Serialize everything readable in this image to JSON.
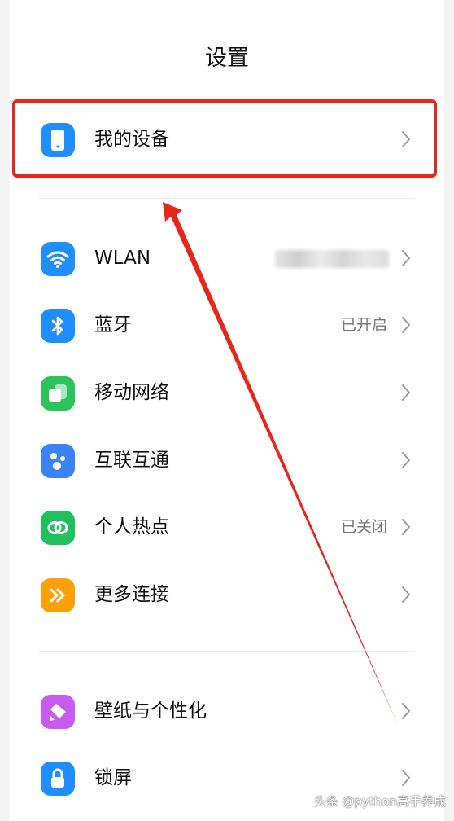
{
  "header": {
    "title": "设置"
  },
  "rows": [
    {
      "label": "我的设备",
      "value": "",
      "icon": "phone-icon",
      "color": "#1f8fff"
    },
    {
      "label": "WLAN",
      "value": "",
      "icon": "wifi-icon",
      "color": "#1f8fff"
    },
    {
      "label": "蓝牙",
      "value": "已开启",
      "icon": "bluetooth-icon",
      "color": "#1f8fff"
    },
    {
      "label": "移动网络",
      "value": "",
      "icon": "mobile-network-icon",
      "color": "#2ac45a"
    },
    {
      "label": "互联互通",
      "value": "",
      "icon": "interconnect-icon",
      "color": "#3b82f6"
    },
    {
      "label": "个人热点",
      "value": "已关闭",
      "icon": "hotspot-icon",
      "color": "#20c05c"
    },
    {
      "label": "更多连接",
      "value": "",
      "icon": "more-connections-icon",
      "color": "#ff9f0a"
    },
    {
      "label": "壁纸与个性化",
      "value": "",
      "icon": "wallpaper-icon",
      "color": "#c85cf0"
    },
    {
      "label": "锁屏",
      "value": "",
      "icon": "lock-icon",
      "color": "#1f8fff"
    }
  ],
  "watermark": "头条 @python高手养成",
  "annotation_color": "#e8261c"
}
